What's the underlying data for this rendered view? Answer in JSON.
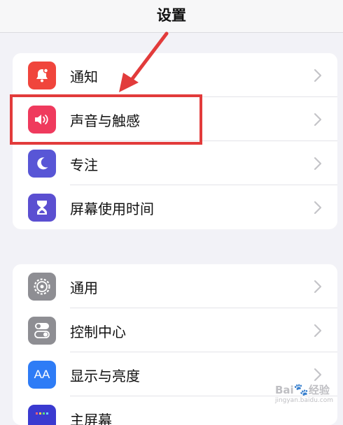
{
  "header": {
    "title": "设置"
  },
  "groups": [
    {
      "items": [
        {
          "label": "通知",
          "icon": "notification-bell-icon",
          "color": "#f0453c"
        },
        {
          "label": "声音与触感",
          "icon": "speaker-sound-icon",
          "color": "#ef3a5d"
        },
        {
          "label": "专注",
          "icon": "moon-icon",
          "color": "#5856d6"
        },
        {
          "label": "屏幕使用时间",
          "icon": "hourglass-icon",
          "color": "#5b4fd1"
        }
      ]
    },
    {
      "items": [
        {
          "label": "通用",
          "icon": "gear-icon",
          "color": "#8e8e93"
        },
        {
          "label": "控制中心",
          "icon": "toggle-switches-icon",
          "color": "#8e8e93"
        },
        {
          "label": "显示与亮度",
          "icon": "text-size-icon",
          "color": "#2e7cf6",
          "glyph": "AA"
        },
        {
          "label": "主屏幕",
          "icon": "home-screen-grid-icon",
          "color": "#3a3ad0"
        }
      ]
    }
  ],
  "annotation": {
    "highlighted_item": "声音与触感",
    "color": "#e23b3b"
  },
  "watermark": {
    "text": "Bai",
    "paw": "🐾",
    "suffix": "经验",
    "sub": "jingyan.baidu.com"
  }
}
